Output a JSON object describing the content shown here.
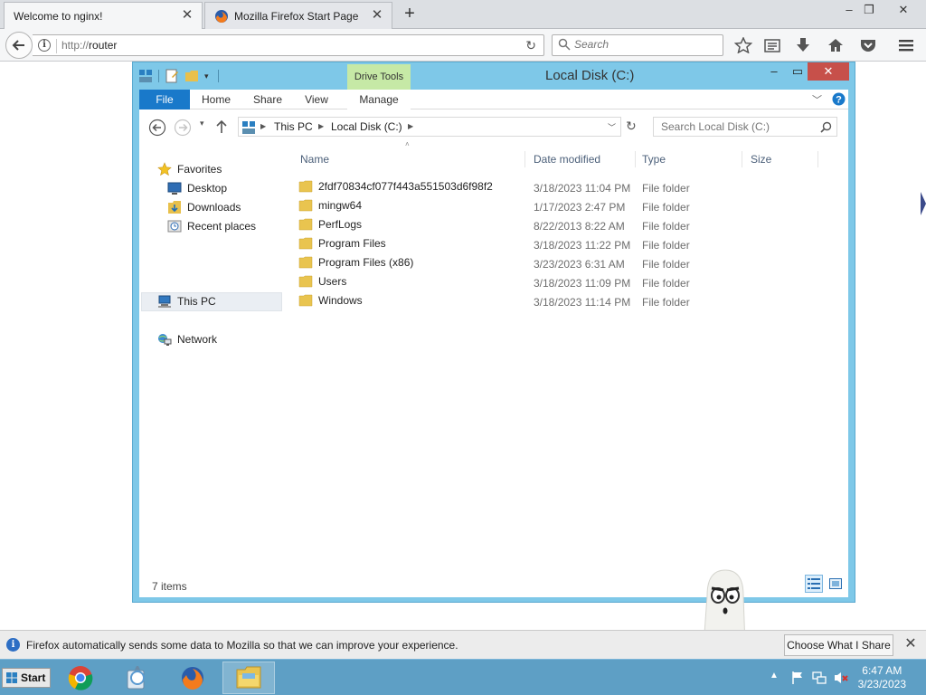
{
  "browser": {
    "tabs": [
      {
        "title": "Welcome to nginx!",
        "active": true
      },
      {
        "title": "Mozilla Firefox Start Page",
        "active": false
      }
    ],
    "url_scheme": "http://",
    "url_host": "router",
    "search_placeholder": "Search"
  },
  "explorer": {
    "title": "Local Disk (C:)",
    "contextual_tab": "Drive Tools",
    "ribbon_tabs": [
      "File",
      "Home",
      "Share",
      "View",
      "Manage"
    ],
    "breadcrumb": [
      "This PC",
      "Local Disk (C:)"
    ],
    "search_placeholder": "Search Local Disk (C:)",
    "nav": {
      "favorites": "Favorites",
      "desktop": "Desktop",
      "downloads": "Downloads",
      "recent": "Recent places",
      "thispc": "This PC",
      "network": "Network"
    },
    "columns": [
      "Name",
      "Date modified",
      "Type",
      "Size"
    ],
    "files": [
      {
        "name": "2fdf70834cf077f443a551503d6f98f2",
        "date": "3/18/2023 11:04 PM",
        "type": "File folder"
      },
      {
        "name": "mingw64",
        "date": "1/17/2023 2:47 PM",
        "type": "File folder"
      },
      {
        "name": "PerfLogs",
        "date": "8/22/2013 8:22 AM",
        "type": "File folder"
      },
      {
        "name": "Program Files",
        "date": "3/18/2023 11:22 PM",
        "type": "File folder"
      },
      {
        "name": "Program Files (x86)",
        "date": "3/23/2023 6:31 AM",
        "type": "File folder"
      },
      {
        "name": "Users",
        "date": "3/18/2023 11:09 PM",
        "type": "File folder"
      },
      {
        "name": "Windows",
        "date": "3/18/2023 11:14 PM",
        "type": "File folder"
      }
    ],
    "status": "7 items"
  },
  "notification": {
    "message": "Firefox automatically sends some data to Mozilla so that we can improve your experience.",
    "button": "Choose What I Share"
  },
  "taskbar": {
    "start_label": "Start",
    "time": "6:47 AM",
    "date": "3/23/2023"
  },
  "colors": {
    "explorer_frame": "#7ec8e8",
    "file_tab": "#1979ca",
    "drive_tools": "#c6e9a6",
    "close_button": "#c7504a",
    "taskbar": "#5e9fc5"
  }
}
